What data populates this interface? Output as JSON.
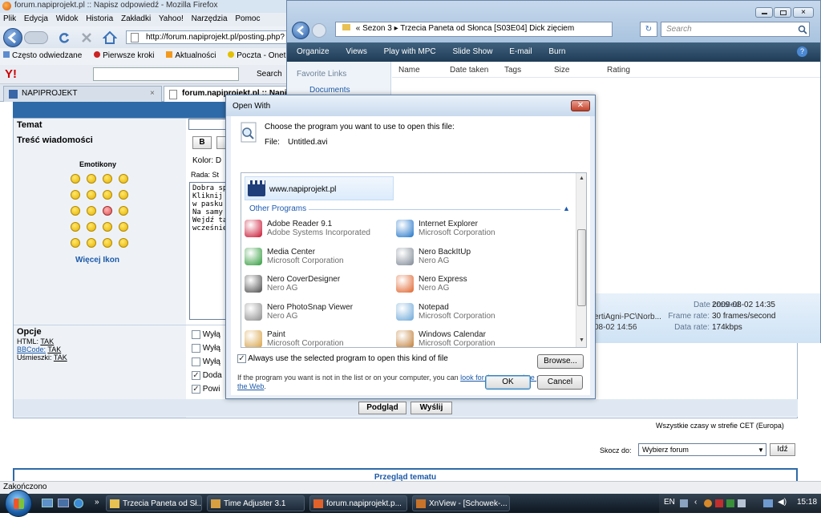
{
  "firefox": {
    "title": "forum.napiprojekt.pl :: Napisz odpowiedź - Mozilla Firefox",
    "menu": [
      "Plik",
      "Edycja",
      "Widok",
      "Historia",
      "Zakładki",
      "Yahoo!",
      "Narzędzia",
      "Pomoc"
    ],
    "url": "http://forum.napiprojekt.pl/posting.php?",
    "bookmarks": [
      "Często odwiedzane",
      "Pierwsze kroki",
      "Aktualności",
      "Poczta - Onet.pl - I"
    ],
    "yahoo_search_label": "Search",
    "tabs": [
      {
        "label": "NAPIPROJEKT"
      },
      {
        "label": "forum.napiprojekt.pl :: Napis"
      }
    ],
    "status": "Zakończono"
  },
  "form": {
    "topic_label": "Temat",
    "content_label": "Treść wiadomości",
    "emoticons_label": "Emotikony",
    "more_icons": "Więcej Ikon",
    "bold_button": "B",
    "color_label": "Kolor: D",
    "font_size_label": "Rada: St",
    "message_lines": [
      "Dobra sp",
      "Kliknij na",
      "w pasku",
      "Na samy",
      "Wejdź ta",
      "wcześnie"
    ],
    "options_title": "Opcje",
    "html_label": "HTML:",
    "html_value": "TAK",
    "bbcode_label": "BBCode:",
    "bbcode_value": "TAK",
    "smilies_label": "Uśmieszki:",
    "smilies_value": "TAK",
    "options": [
      {
        "label": "Wyłą",
        "checked": false
      },
      {
        "label": "Wyłą",
        "checked": false
      },
      {
        "label": "Wyłą",
        "checked": false
      },
      {
        "label": "Doda",
        "checked": true
      },
      {
        "label": "Powi",
        "checked": true
      }
    ],
    "preview_button": "Podgląd",
    "send_button": "Wyślij",
    "timezone_text": "Wszystkie czasy w strefie CET (Europa)",
    "jump_label": "Skocz do:",
    "jump_select": "Wybierz forum",
    "go_button": "Idź",
    "topic_review": "Przegląd tematu"
  },
  "explorer": {
    "breadcrumb": [
      "Sezon 3",
      "Trzecia Paneta od Słonca [S03E04] Dick zięciem"
    ],
    "search_placeholder": "Search",
    "toolbar": [
      "Organize",
      "Views",
      "Play with MPC",
      "Slide Show",
      "E-mail",
      "Burn"
    ],
    "favorite_links_label": "Favorite Links",
    "documents_label": "Documents",
    "columns": [
      "Name",
      "Date taken",
      "Tags",
      "Size",
      "Rating"
    ],
    "details": {
      "owner_fragment": "ertiAgni-PC\\Norb...",
      "date_fragment": "08-02 14:56",
      "date_created_label": "Date created:",
      "date_created_value": "2009-08-02 14:35",
      "frame_rate_label": "Frame rate:",
      "frame_rate_value": "30 frames/second",
      "data_rate_label": "Data rate:",
      "data_rate_value": "174kbps"
    }
  },
  "dialog": {
    "title": "Open With",
    "prompt": "Choose the program you want to use to open this file:",
    "file_label": "File:",
    "file_name": "Untitled.avi",
    "recommended": "www.napiprojekt.pl",
    "other_programs_label": "Other Programs",
    "programs": [
      {
        "name": "Adobe Reader 9.1",
        "company": "Adobe Systems Incorporated",
        "icon": "adobe-reader-icon",
        "color": "#c8102e"
      },
      {
        "name": "Internet Explorer",
        "company": "Microsoft Corporation",
        "icon": "internet-explorer-icon",
        "color": "#1e73c8"
      },
      {
        "name": "Media Center",
        "company": "Microsoft Corporation",
        "icon": "media-center-icon",
        "color": "#2e9a3a"
      },
      {
        "name": "Nero BackItUp",
        "company": "Nero AG",
        "icon": "nero-backitup-icon",
        "color": "#7d8793"
      },
      {
        "name": "Nero CoverDesigner",
        "company": "Nero AG",
        "icon": "nero-coverdesigner-icon",
        "color": "#4a4a4a"
      },
      {
        "name": "Nero Express",
        "company": "Nero AG",
        "icon": "nero-express-icon",
        "color": "#e0622a"
      },
      {
        "name": "Nero PhotoSnap Viewer",
        "company": "Nero AG",
        "icon": "nero-photosnap-icon",
        "color": "#8a8a8a"
      },
      {
        "name": "Notepad",
        "company": "Microsoft Corporation",
        "icon": "notepad-icon",
        "color": "#6aa6d8"
      },
      {
        "name": "Paint",
        "company": "Microsoft Corporation",
        "icon": "paint-icon",
        "color": "#d8a040"
      },
      {
        "name": "Windows Calendar",
        "company": "Microsoft Corporation",
        "icon": "windows-calendar-icon",
        "color": "#c07a30"
      }
    ],
    "always_use_label": "Always use the selected program to open this kind of file",
    "always_use_checked": true,
    "browse_button": "Browse...",
    "hint_text": "If the program you want is not in the list or on your computer, you can",
    "hint_link": "look for the appropriate program on the Web",
    "hint_end": ".",
    "ok_button": "OK",
    "cancel_button": "Cancel"
  },
  "taskbar": {
    "buttons": [
      "Trzecia Paneta od Sł...",
      "Time Adjuster 3.1",
      "forum.napiprojekt.p...",
      "XnView - [Schowek-..."
    ],
    "language": "EN",
    "clock": "15:18"
  }
}
